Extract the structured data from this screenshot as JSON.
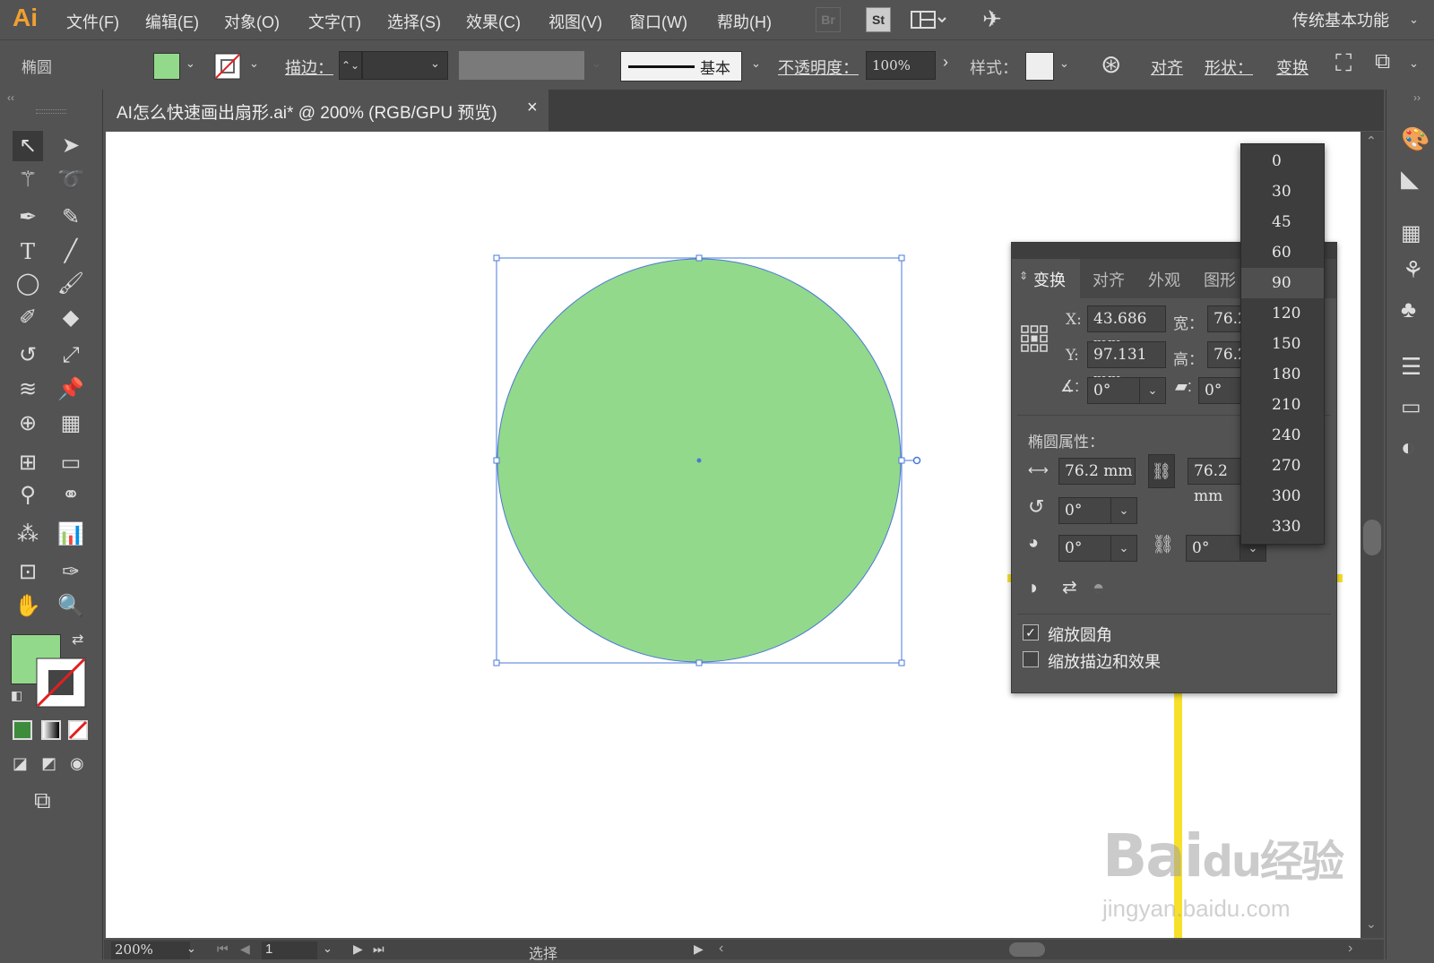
{
  "app": {
    "logo": "Ai",
    "workspace": "传统基本功能"
  },
  "menus": [
    "文件(F)",
    "编辑(E)",
    "对象(O)",
    "文字(T)",
    "选择(S)",
    "效果(C)",
    "视图(V)",
    "窗口(W)",
    "帮助(H)"
  ],
  "topicons": {
    "br": "Br",
    "st": "St"
  },
  "control": {
    "object_type": "椭圆",
    "stroke_label": "描边：",
    "brush_label": "基本",
    "opacity_label": "不透明度：",
    "opacity_value": "100%",
    "style_label": "样式：",
    "align_label": "对齐",
    "shape_label": "形状：",
    "transform_label": "变换",
    "fill_color": "#93d98b"
  },
  "document": {
    "tab_title": "AI怎么快速画出扇形.ai* @ 200% (RGB/GPU 预览)",
    "close": "×"
  },
  "canvas": {
    "ellipse_color": "#93d98b",
    "selection_color": "#4a78d8"
  },
  "panel": {
    "tabs": [
      "变换",
      "对齐",
      "外观",
      "图形"
    ],
    "x_label": "X:",
    "x_value": "43.686 mm",
    "y_label": "Y:",
    "y_value": "97.131 mm",
    "w_label": "宽：",
    "w_value": "76.2",
    "h_label": "高：",
    "h_value": "76.2",
    "angle_value": "0°",
    "shear_value": "0°",
    "ellipse_props_label": "椭圆属性：",
    "ellipse_w": "76.2 mm",
    "ellipse_h": "76.2 mm",
    "rotate_value": "0°",
    "pie_start_value": "0°",
    "pie_end_value": "0°",
    "scale_corners_label": "缩放圆角",
    "scale_corners_checked": true,
    "scale_strokes_label": "缩放描边和效果",
    "scale_strokes_checked": false
  },
  "dropdown": {
    "options": [
      "0",
      "30",
      "45",
      "60",
      "90",
      "120",
      "150",
      "180",
      "210",
      "240",
      "270",
      "300",
      "330"
    ],
    "highlighted": "90"
  },
  "status": {
    "zoom": "200%",
    "page": "1",
    "tool": "选择"
  },
  "annotation": {
    "color": "#f7e02a"
  },
  "watermark": {
    "text1": "Bai",
    "text2": "du",
    "text3": "经验",
    "text4": "jingyan.baidu.com"
  }
}
